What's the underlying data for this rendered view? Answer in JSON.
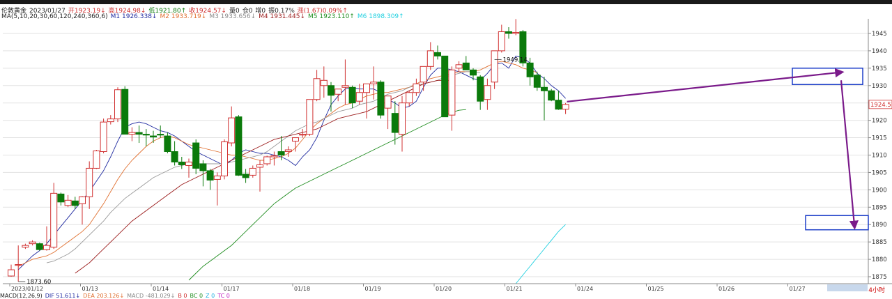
{
  "header": {
    "symbol": "伦敦黄金",
    "date": "2023/01/27",
    "open": "开1923.19↓",
    "high": "高1924.98↓",
    "low": "低1921.80↑",
    "close": "收1924.57↓",
    "volume": "量0",
    "oi": "仓0",
    "oi_inc": "增0",
    "amplitude": "振0.17%",
    "change": "涨(1.67)0.09%↑"
  },
  "ma_info": {
    "title": "MA(5,10,20,30,60,120,240,360,6)",
    "m1": "M1 1926.338↓",
    "m2": "M2 1933.719↓",
    "m3": "M3 1933.656↓",
    "m4": "M4 1931.445↓",
    "m5": "M5 1923.110↑",
    "m6": "M6 1898.309↑"
  },
  "bottom_info": {
    "macd_title": "MACD(12,26,9)",
    "dif": "DIF 51.611↓",
    "dea": "DEA 203.126↓",
    "macd": "MACD -481.029↓",
    "b": "B 0",
    "bc": "BC 0",
    "z": "Z 0",
    "tc": "TC 0"
  },
  "period_label": "4小时",
  "colors": {
    "up": "#d03030",
    "down": "#0b7a0b",
    "m1": "#1f2aa0",
    "m2": "#e07030",
    "m3": "#9a9a9a",
    "m4": "#9b1b1b",
    "m5": "#1e8c1e",
    "m6": "#20d0e0",
    "box": "#1e3fc8",
    "arrow": "#7a1a8a"
  },
  "chart_data": {
    "type": "candlestick",
    "ylim": [
      1873,
      1948
    ],
    "y_ticks": [
      1875,
      1880,
      1885,
      1890,
      1895,
      1900,
      1905,
      1910,
      1915,
      1920,
      1925,
      1930,
      1935,
      1940,
      1945
    ],
    "x_tick_labels": [
      "2023/01/12",
      "01/13",
      "01/14",
      "01/17",
      "01/18",
      "01/19",
      "01/20",
      "01/21",
      "01/24",
      "01/25",
      "01/26",
      "01/27"
    ],
    "last_price_label": "1924.57",
    "annotations": [
      {
        "text": "1949.14",
        "candle": 68
      },
      {
        "text": "1873.60",
        "candle": 1
      }
    ],
    "candles": [
      [
        1875.2,
        1878.5,
        1875.0,
        1877.0
      ],
      [
        1878.5,
        1884.0,
        1873.6,
        1878.5
      ],
      [
        1883.5,
        1884.5,
        1883.0,
        1884.0
      ],
      [
        1884.5,
        1885.5,
        1884.0,
        1885.0
      ],
      [
        1884.5,
        1884.8,
        1882.5,
        1882.8
      ],
      [
        1882.8,
        1889.5,
        1882.5,
        1884.0
      ],
      [
        1883.5,
        1902.0,
        1883.0,
        1899.0
      ],
      [
        1898.8,
        1899.2,
        1895.5,
        1896.5
      ],
      [
        1895.5,
        1898.5,
        1895.0,
        1897.0
      ],
      [
        1896.8,
        1898.0,
        1894.5,
        1895.5
      ],
      [
        1896.0,
        1898.2,
        1890.0,
        1898.0
      ],
      [
        1898.0,
        1908.2,
        1894.5,
        1906.2
      ],
      [
        1906.2,
        1911.5,
        1906.0,
        1911.2
      ],
      [
        1911.0,
        1920.5,
        1910.5,
        1919.5
      ],
      [
        1919.6,
        1921.5,
        1918.8,
        1920.4
      ],
      [
        1920.4,
        1929.5,
        1919.5,
        1928.8
      ],
      [
        1928.9,
        1929.8,
        1918.5,
        1916.0
      ],
      [
        1916.0,
        1918.0,
        1914.0,
        1916.5
      ],
      [
        1916.5,
        1918.5,
        1913.5,
        1916.0
      ],
      [
        1916.0,
        1917.5,
        1912.5,
        1915.8
      ],
      [
        1915.5,
        1917.0,
        1913.5,
        1915.2
      ],
      [
        1916.0,
        1918.5,
        1915.0,
        1915.8
      ],
      [
        1915.5,
        1916.5,
        1910.5,
        1911.0
      ],
      [
        1911.0,
        1914.0,
        1907.0,
        1908.0
      ],
      [
        1908.0,
        1909.5,
        1906.0,
        1907.2
      ],
      [
        1907.0,
        1909.0,
        1903.5,
        1908.0
      ],
      [
        1913.5,
        1914.5,
        1904.5,
        1906.2
      ],
      [
        1907.5,
        1908.5,
        1901.0,
        1905.5
      ],
      [
        1905.5,
        1906.0,
        1900.0,
        1902.8
      ],
      [
        1903.0,
        1905.0,
        1895.5,
        1904.0
      ],
      [
        1904.0,
        1914.5,
        1903.0,
        1913.8
      ],
      [
        1913.5,
        1924.0,
        1912.5,
        1920.7
      ],
      [
        1921.0,
        1921.5,
        1904.0,
        1904.2
      ],
      [
        1904.5,
        1906.0,
        1902.0,
        1903.5
      ],
      [
        1904.2,
        1907.0,
        1903.5,
        1906.2
      ],
      [
        1906.5,
        1908.5,
        1899.5,
        1907.2
      ],
      [
        1907.5,
        1909.8,
        1907.0,
        1909.5
      ],
      [
        1909.5,
        1911.0,
        1907.0,
        1909.8
      ],
      [
        1911.0,
        1915.5,
        1908.5,
        1910.0
      ],
      [
        1911.0,
        1912.5,
        1909.5,
        1911.5
      ],
      [
        1914.0,
        1915.0,
        1911.0,
        1915.0
      ],
      [
        1916.0,
        1917.5,
        1915.0,
        1916.0
      ],
      [
        1916.0,
        1926.0,
        1915.5,
        1926.0
      ],
      [
        1926.0,
        1934.5,
        1925.5,
        1932.0
      ],
      [
        1930.0,
        1935.5,
        1926.5,
        1931.5
      ],
      [
        1930.0,
        1931.0,
        1922.5,
        1927.2
      ],
      [
        1927.5,
        1929.0,
        1925.5,
        1929.0
      ],
      [
        1929.5,
        1937.5,
        1924.5,
        1930.0
      ],
      [
        1929.5,
        1930.0,
        1923.5,
        1925.0
      ],
      [
        1925.5,
        1930.5,
        1924.5,
        1928.0
      ],
      [
        1928.0,
        1930.5,
        1920.5,
        1930.5
      ],
      [
        1930.5,
        1935.5,
        1926.0,
        1931.0
      ],
      [
        1931.0,
        1931.5,
        1920.5,
        1921.5
      ],
      [
        1923.5,
        1927.0,
        1917.5,
        1927.0
      ],
      [
        1922.0,
        1925.5,
        1913.0,
        1916.5
      ],
      [
        1916.0,
        1927.0,
        1911.0,
        1925.0
      ],
      [
        1925.0,
        1928.5,
        1924.0,
        1928.0
      ],
      [
        1928.0,
        1932.0,
        1927.0,
        1930.5
      ],
      [
        1931.0,
        1934.0,
        1928.5,
        1935.5
      ],
      [
        1935.5,
        1942.5,
        1934.5,
        1940.0
      ],
      [
        1939.5,
        1941.5,
        1937.5,
        1938.5
      ],
      [
        1938.5,
        1938.0,
        1921.0,
        1921.0
      ],
      [
        1921.5,
        1935.5,
        1917.0,
        1934.5
      ],
      [
        1935.0,
        1937.0,
        1934.0,
        1936.0
      ],
      [
        1936.5,
        1938.5,
        1934.5,
        1934.5
      ],
      [
        1934.5,
        1935.0,
        1931.5,
        1933.0
      ],
      [
        1932.5,
        1933.0,
        1923.0,
        1925.5
      ],
      [
        1926.0,
        1932.0,
        1923.0,
        1930.0
      ],
      [
        1931.0,
        1937.5,
        1929.0,
        1940.0
      ],
      [
        1940.0,
        1947.5,
        1939.5,
        1945.5
      ],
      [
        1945.5,
        1946.8,
        1943.5,
        1945.0
      ],
      [
        1945.0,
        1949.14,
        1944.5,
        1945.3
      ],
      [
        1945.5,
        1946.0,
        1935.5,
        1936.5
      ],
      [
        1936.5,
        1938.0,
        1930.0,
        1932.5
      ],
      [
        1933.0,
        1934.0,
        1928.5,
        1929.5
      ],
      [
        1929.5,
        1932.5,
        1920.0,
        1928.5
      ],
      [
        1928.5,
        1929.0,
        1925.5,
        1925.8
      ],
      [
        1925.8,
        1928.5,
        1923.0,
        1923.2
      ],
      [
        1923.19,
        1924.98,
        1921.8,
        1924.57
      ]
    ],
    "ma_series": [
      {
        "name": "M1",
        "start": 1,
        "values": [
          1877.0,
          1879.0,
          1881.0,
          1882.5,
          1884.5,
          1887.0,
          1889.5,
          1892.0,
          1894.5,
          1897.0,
          1899.5,
          1902.5,
          1905.5,
          1909.5,
          1914.0,
          1918.0,
          1919.0,
          1919.5,
          1919.0,
          1918.0,
          1917.0,
          1916.5,
          1915.5,
          1914.0,
          1912.5,
          1911.0,
          1910.0,
          1909.0,
          1908.0,
          1907.0,
          1908.5,
          1910.5,
          1911.5,
          1911.0,
          1910.5,
          1910.5,
          1910.0,
          1909.5,
          1908.5,
          1907.0,
          1909.5,
          1911.5,
          1915.0,
          1920.0,
          1924.5,
          1927.0,
          1929.0,
          1929.5,
          1929.0,
          1929.0,
          1929.0,
          1928.0,
          1926.0,
          1925.0,
          1923.5,
          1924.0,
          1925.5,
          1929.5,
          1933.0,
          1935.0,
          1935.0,
          1934.5,
          1934.0,
          1933.0,
          1932.0,
          1931.5,
          1933.5,
          1936.0,
          1936.5,
          1935.0,
          1938.5,
          1938.0,
          1936.5,
          1933.5,
          1932.0,
          1930.0,
          1928.5,
          1926.3
        ]
      },
      {
        "name": "M2",
        "start": 1,
        "values": [
          1878.0,
          1879.0,
          1880.0,
          1880.5,
          1881.0,
          1882.0,
          1883.5,
          1885.0,
          1886.5,
          1888.0,
          1890.0,
          1893.0,
          1896.0,
          1899.5,
          1903.0,
          1906.0,
          1908.5,
          1910.5,
          1912.5,
          1914.0,
          1915.0,
          1915.5,
          1915.0,
          1914.0,
          1913.0,
          1912.5,
          1912.0,
          1911.5,
          1911.0,
          1910.5,
          1910.0,
          1910.0,
          1909.5,
          1909.0,
          1908.5,
          1908.5,
          1909.0,
          1909.5,
          1910.5,
          1912.0,
          1914.5,
          1917.0,
          1919.0,
          1920.5,
          1922.0,
          1923.5,
          1924.5,
          1925.0,
          1926.0,
          1927.0,
          1927.5,
          1928.0,
          1928.0,
          1928.5,
          1929.0,
          1929.5,
          1930.5,
          1931.5,
          1932.0,
          1932.5,
          1933.0,
          1933.5,
          1934.0,
          1934.0,
          1934.0,
          1934.5,
          1935.5,
          1936.5,
          1937.0,
          1936.5,
          1936.0,
          1935.0,
          1934.5,
          1933.7
        ]
      },
      {
        "name": "M3",
        "start": 5,
        "values": [
          1879.0,
          1879.5,
          1880.5,
          1881.5,
          1883.0,
          1885.0,
          1887.0,
          1889.0,
          1891.0,
          1893.5,
          1895.5,
          1897.5,
          1899.0,
          1900.5,
          1902.0,
          1903.5,
          1904.5,
          1905.5,
          1906.5,
          1907.0,
          1907.5,
          1907.5,
          1907.5,
          1907.5,
          1907.5,
          1907.5,
          1908.0,
          1908.5,
          1909.0,
          1909.5,
          1910.0,
          1911.0,
          1912.5,
          1914.0,
          1915.5,
          1917.0,
          1918.0,
          1919.0,
          1919.5,
          1920.5,
          1921.5,
          1922.5,
          1923.0,
          1923.5,
          1924.5,
          1925.0,
          1925.5,
          1926.5,
          1927.5,
          1928.0,
          1928.5,
          1929.5,
          1930.0,
          1930.5,
          1931.0,
          1931.5,
          1932.5,
          1933.0,
          1933.5,
          1934.0,
          1934.0,
          1933.7
        ]
      },
      {
        "name": "M4",
        "start": 9,
        "values": [
          1876.0,
          1877.5,
          1879.0,
          1881.0,
          1883.0,
          1885.0,
          1887.0,
          1889.0,
          1891.0,
          1892.5,
          1894.0,
          1895.5,
          1897.0,
          1898.5,
          1900.0,
          1901.5,
          1902.5,
          1903.5,
          1904.5,
          1905.5,
          1906.5,
          1907.5,
          1908.5,
          1909.5,
          1910.5,
          1911.5,
          1912.5,
          1913.5,
          1914.5,
          1915.0,
          1915.5,
          1916.0,
          1916.5,
          1917.0,
          1917.5,
          1918.5,
          1919.5,
          1920.5,
          1921.0,
          1921.5,
          1922.0,
          1922.5,
          1923.5,
          1924.5,
          1925.5,
          1926.5,
          1927.5,
          1928.5,
          1929.5,
          1930.5,
          1931.0,
          1931.5,
          1931.5,
          1931.5
        ]
      },
      {
        "name": "M5",
        "start": 25,
        "values": [
          1874.0,
          1876.0,
          1878.0,
          1879.5,
          1881.0,
          1882.5,
          1884.0,
          1886.0,
          1888.0,
          1890.0,
          1892.0,
          1894.0,
          1896.0,
          1897.5,
          1899.0,
          1900.5,
          1901.5,
          1902.5,
          1903.5,
          1904.5,
          1905.5,
          1906.5,
          1907.5,
          1908.5,
          1909.5,
          1910.5,
          1911.5,
          1912.5,
          1913.5,
          1914.5,
          1915.5,
          1916.5,
          1917.5,
          1918.5,
          1919.5,
          1920.5,
          1921.5,
          1922.3,
          1922.9,
          1923.1
        ]
      },
      {
        "name": "M6",
        "start": 71,
        "values": [
          1873.0,
          1875.5,
          1878.0,
          1880.5,
          1883.0,
          1885.5,
          1888.0,
          1890.0
        ]
      }
    ]
  }
}
